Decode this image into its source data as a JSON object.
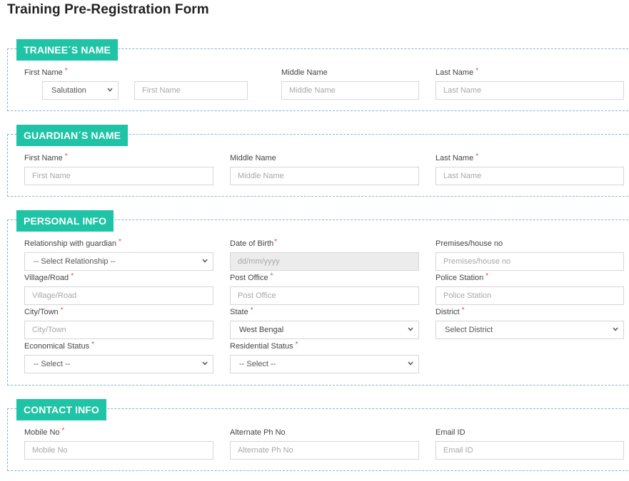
{
  "page": {
    "title": "Training Pre-Registration Form"
  },
  "colors": {
    "accent": "#1fc3a5",
    "border_dashed": "#7fbcc4",
    "required": "#e04848"
  },
  "trainee": {
    "legend": "TRAINEE´S NAME",
    "first_name_label": "First Name",
    "salutation_value": "Salutation",
    "first_name_placeholder": "First Name",
    "middle_name_label": "Middle Name",
    "middle_name_placeholder": "Middle Name",
    "last_name_label": "Last Name",
    "last_name_placeholder": "Last Name"
  },
  "guardian": {
    "legend": "GUARDIAN´S NAME",
    "first_name_label": "First Name",
    "first_name_placeholder": "First Name",
    "middle_name_label": "Middle Name",
    "middle_name_placeholder": "Middle Name",
    "last_name_label": "Last Name",
    "last_name_placeholder": "Last Name"
  },
  "personal": {
    "legend": "PERSONAL INFO",
    "relationship_label": "Relationship with guardian",
    "relationship_value": "-- Select Relationship --",
    "dob_label": "Date of Birth",
    "dob_placeholder": "dd/mm/yyyy",
    "premises_label": "Premises/house no",
    "premises_placeholder": "Premises/house no",
    "village_label": "Village/Road",
    "village_placeholder": "Village/Road",
    "post_office_label": "Post Office",
    "post_office_placeholder": "Post Office",
    "police_station_label": "Police Station",
    "police_station_placeholder": "Police Station",
    "city_label": "City/Town",
    "city_placeholder": "City/Town",
    "state_label": "State",
    "state_value": "West Bengal",
    "district_label": "District",
    "district_value": "Select District",
    "economical_label": "Economical Status",
    "economical_value": "-- Select --",
    "residential_label": "Residential Status",
    "residential_value": "-- Select --"
  },
  "contact": {
    "legend": "CONTACT INFO",
    "mobile_label": "Mobile No",
    "mobile_placeholder": "Mobile No",
    "alternate_label": "Alternate Ph No",
    "alternate_placeholder": "Alternate Ph No",
    "email_label": "Email ID",
    "email_placeholder": "Email ID"
  },
  "required_mark": "*"
}
